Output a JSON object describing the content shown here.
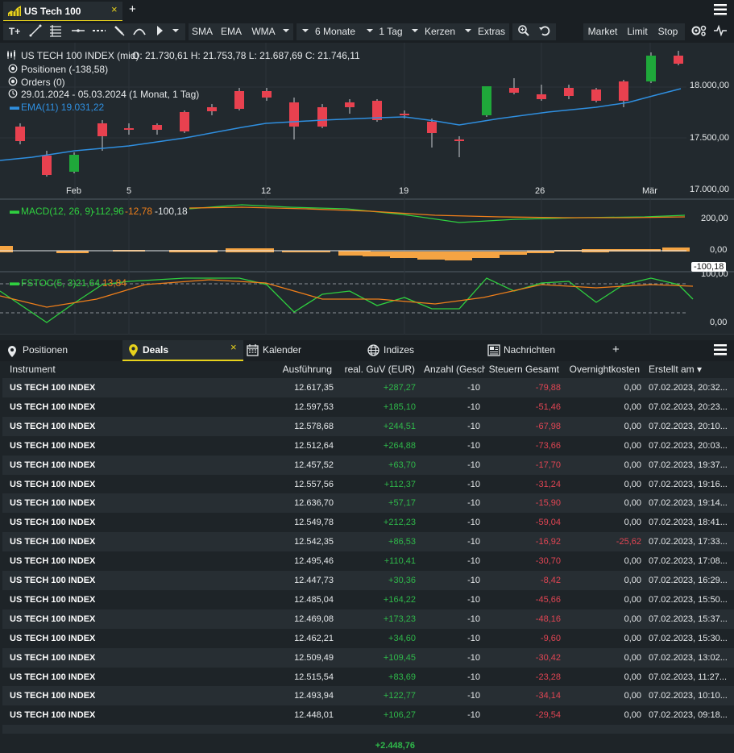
{
  "tabs": {
    "main_label": "US Tech 100",
    "close_glyph": "×",
    "add_glyph": "+"
  },
  "toolbar": {
    "text_tool": "T+",
    "sma": "SMA",
    "ema": "EMA",
    "wma": "WMA",
    "period": "6 Monate",
    "interval": "1 Tag",
    "chart_type": "Kerzen",
    "extras": "Extras",
    "market": "Market",
    "limit": "Limit",
    "stop": "Stop"
  },
  "chart": {
    "instrument_line": "US TECH 100 INDEX (mid)",
    "ohlc": "O: 21.730,61  H: 21.753,78  L: 21.687,69  C: 21.746,11",
    "positions": "Positionen (-138,58)",
    "orders": "Orders (0)",
    "range": "29.01.2024 - 05.03.2024  (1 Monat, 1 Tag)",
    "ema_label": "EMA(11)  19.031,22",
    "price_axis": [
      "18.000,00",
      "17.500,00",
      "17.000,00"
    ],
    "date_axis": [
      "Feb",
      "5",
      "12",
      "19",
      "26",
      "Mär"
    ],
    "macd_label": "MACD(12, 26, 9)",
    "macd_v1": "-112,96",
    "macd_v2": "-12,78",
    "macd_v3": "-100,18",
    "macd_axis": [
      "200,00",
      "0,00"
    ],
    "macd_marker": "-100,18",
    "fstoc_label": "FSTOC(5, 3)",
    "fstoc_v1": "21,64",
    "fstoc_v2": "13,84",
    "fstoc_axis": [
      "100,00",
      "0,00"
    ],
    "colors": {
      "up": "#1fa83a",
      "down": "#e8414f",
      "ema": "#2f8fe0",
      "macd": "#2fd03f",
      "signal": "#f07f1a"
    }
  },
  "bottom_tabs": {
    "positions": "Positionen",
    "deals": "Deals",
    "calendar": "Kalender",
    "indices": "Indizes",
    "news": "Nachrichten",
    "add": "+",
    "close_glyph": "×"
  },
  "table": {
    "headers": [
      "Instrument",
      "Ausführung",
      "real. GuV (EUR)",
      "Anzahl (Geschl",
      "Steuern Gesamt",
      "Overnightkosten",
      "Erstellt am ▾"
    ],
    "rows": [
      {
        "instrument": "US TECH 100 INDEX",
        "ausfuehrung": "12.617,35",
        "guv": "+287,27",
        "anzahl": "-10",
        "steuern": "-79,88",
        "overnight": "0,00",
        "erstellt": "07.02.2023, 20:32..."
      },
      {
        "instrument": "US TECH 100 INDEX",
        "ausfuehrung": "12.597,53",
        "guv": "+185,10",
        "anzahl": "-10",
        "steuern": "-51,46",
        "overnight": "0,00",
        "erstellt": "07.02.2023, 20:23..."
      },
      {
        "instrument": "US TECH 100 INDEX",
        "ausfuehrung": "12.578,68",
        "guv": "+244,51",
        "anzahl": "-10",
        "steuern": "-67,98",
        "overnight": "0,00",
        "erstellt": "07.02.2023, 20:10..."
      },
      {
        "instrument": "US TECH 100 INDEX",
        "ausfuehrung": "12.512,64",
        "guv": "+264,88",
        "anzahl": "-10",
        "steuern": "-73,66",
        "overnight": "0,00",
        "erstellt": "07.02.2023, 20:03..."
      },
      {
        "instrument": "US TECH 100 INDEX",
        "ausfuehrung": "12.457,52",
        "guv": "+63,70",
        "anzahl": "-10",
        "steuern": "-17,70",
        "overnight": "0,00",
        "erstellt": "07.02.2023, 19:37..."
      },
      {
        "instrument": "US TECH 100 INDEX",
        "ausfuehrung": "12.557,56",
        "guv": "+112,37",
        "anzahl": "-10",
        "steuern": "-31,24",
        "overnight": "0,00",
        "erstellt": "07.02.2023, 19:16..."
      },
      {
        "instrument": "US TECH 100 INDEX",
        "ausfuehrung": "12.636,70",
        "guv": "+57,17",
        "anzahl": "-10",
        "steuern": "-15,90",
        "overnight": "0,00",
        "erstellt": "07.02.2023, 19:14..."
      },
      {
        "instrument": "US TECH 100 INDEX",
        "ausfuehrung": "12.549,78",
        "guv": "+212,23",
        "anzahl": "-10",
        "steuern": "-59,04",
        "overnight": "0,00",
        "erstellt": "07.02.2023, 18:41..."
      },
      {
        "instrument": "US TECH 100 INDEX",
        "ausfuehrung": "12.542,35",
        "guv": "+86,53",
        "anzahl": "-10",
        "steuern": "-16,92",
        "overnight": "-25,62",
        "erstellt": "07.02.2023, 17:33..."
      },
      {
        "instrument": "US TECH 100 INDEX",
        "ausfuehrung": "12.495,46",
        "guv": "+110,41",
        "anzahl": "-10",
        "steuern": "-30,70",
        "overnight": "0,00",
        "erstellt": "07.02.2023, 17:08..."
      },
      {
        "instrument": "US TECH 100 INDEX",
        "ausfuehrung": "12.447,73",
        "guv": "+30,36",
        "anzahl": "-10",
        "steuern": "-8,42",
        "overnight": "0,00",
        "erstellt": "07.02.2023, 16:29..."
      },
      {
        "instrument": "US TECH 100 INDEX",
        "ausfuehrung": "12.485,04",
        "guv": "+164,22",
        "anzahl": "-10",
        "steuern": "-45,66",
        "overnight": "0,00",
        "erstellt": "07.02.2023, 15:50..."
      },
      {
        "instrument": "US TECH 100 INDEX",
        "ausfuehrung": "12.469,08",
        "guv": "+173,23",
        "anzahl": "-10",
        "steuern": "-48,16",
        "overnight": "0,00",
        "erstellt": "07.02.2023, 15:37..."
      },
      {
        "instrument": "US TECH 100 INDEX",
        "ausfuehrung": "12.462,21",
        "guv": "+34,60",
        "anzahl": "-10",
        "steuern": "-9,60",
        "overnight": "0,00",
        "erstellt": "07.02.2023, 15:30..."
      },
      {
        "instrument": "US TECH 100 INDEX",
        "ausfuehrung": "12.509,49",
        "guv": "+109,45",
        "anzahl": "-10",
        "steuern": "-30,42",
        "overnight": "0,00",
        "erstellt": "07.02.2023, 13:02..."
      },
      {
        "instrument": "US TECH 100 INDEX",
        "ausfuehrung": "12.515,54",
        "guv": "+83,69",
        "anzahl": "-10",
        "steuern": "-23,28",
        "overnight": "0,00",
        "erstellt": "07.02.2023, 11:27..."
      },
      {
        "instrument": "US TECH 100 INDEX",
        "ausfuehrung": "12.493,94",
        "guv": "+122,77",
        "anzahl": "-10",
        "steuern": "-34,14",
        "overnight": "0,00",
        "erstellt": "07.02.2023, 10:10..."
      },
      {
        "instrument": "US TECH 100 INDEX",
        "ausfuehrung": "12.448,01",
        "guv": "+106,27",
        "anzahl": "-10",
        "steuern": "-29,54",
        "overnight": "0,00",
        "erstellt": "07.02.2023, 09:18..."
      }
    ],
    "total_guv": "+2.448,76"
  }
}
